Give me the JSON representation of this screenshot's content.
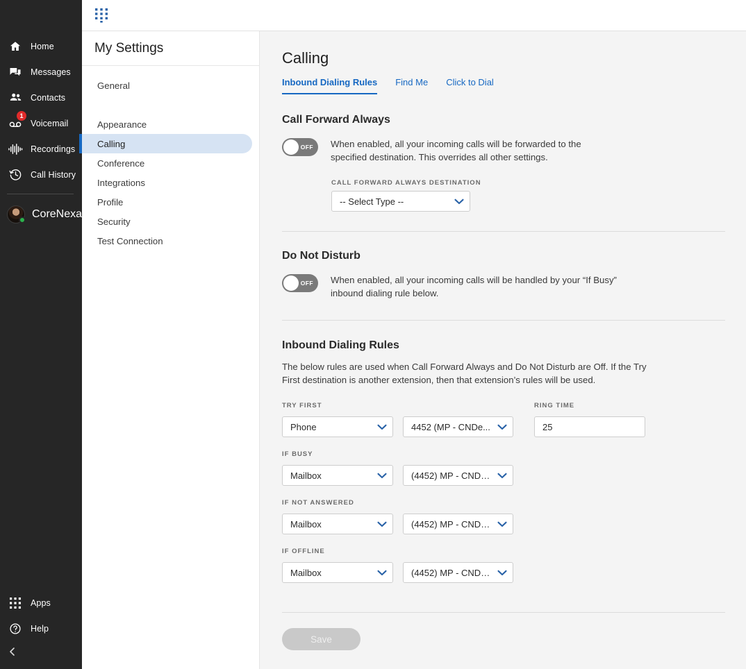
{
  "colors": {
    "rail_bg": "#262626",
    "accent_blue": "#1668c2",
    "active_nav_bg": "#d6e3f3",
    "main_bg": "#f4f4f4",
    "toggle_off": "#7a7a7a",
    "badge_red": "#e02b2b",
    "status_green": "#2bb24c",
    "save_disabled": "#c9c9c9"
  },
  "rail": {
    "items": [
      {
        "label": "Home",
        "icon": "home-icon",
        "badge": null
      },
      {
        "label": "Messages",
        "icon": "messages-icon",
        "badge": null
      },
      {
        "label": "Contacts",
        "icon": "contacts-icon",
        "badge": null
      },
      {
        "label": "Voicemail",
        "icon": "voicemail-icon",
        "badge": "1"
      },
      {
        "label": "Recordings",
        "icon": "recordings-icon",
        "badge": null
      },
      {
        "label": "Call History",
        "icon": "call-history-icon",
        "badge": null
      }
    ],
    "user": {
      "name": "CoreNexa",
      "presence": "online"
    },
    "bottom_items": [
      {
        "label": "Apps",
        "icon": "apps-grid-icon"
      },
      {
        "label": "Help",
        "icon": "help-circle-icon"
      }
    ],
    "collapse_icon": "chevron-left-icon"
  },
  "topbar": {
    "dialpad_icon": "dialpad-icon"
  },
  "settings": {
    "title": "My Settings",
    "items": [
      {
        "label": "General",
        "active": false
      },
      {
        "label": "Appearance",
        "active": false
      },
      {
        "label": "Calling",
        "active": true
      },
      {
        "label": "Conference",
        "active": false
      },
      {
        "label": "Integrations",
        "active": false
      },
      {
        "label": "Profile",
        "active": false
      },
      {
        "label": "Security",
        "active": false
      },
      {
        "label": "Test Connection",
        "active": false
      }
    ]
  },
  "main": {
    "page_title": "Calling",
    "tabs": [
      {
        "label": "Inbound Dialing Rules",
        "active": true
      },
      {
        "label": "Find Me",
        "active": false
      },
      {
        "label": "Click to Dial",
        "active": false
      }
    ],
    "call_forward_always": {
      "title": "Call Forward Always",
      "toggle_state": "OFF",
      "description": "When enabled, all your incoming calls will be forwarded to the specified destination. This overrides all other settings.",
      "dest_label": "CALL FORWARD ALWAYS DESTINATION",
      "dest_value": "-- Select Type --"
    },
    "do_not_disturb": {
      "title": "Do Not Disturb",
      "toggle_state": "OFF",
      "description": "When enabled, all your incoming calls will be handled by your “If Busy” inbound dialing rule below."
    },
    "inbound_dialing_rules": {
      "title": "Inbound Dialing Rules",
      "description": "The below rules are used when Call Forward Always and Do Not Disturb are Off. If the Try First destination is another extension, then that extension’s rules will be used.",
      "ring_time_label": "RING TIME",
      "ring_time_value": "25",
      "rows": [
        {
          "label": "TRY FIRST",
          "type_value": "Phone",
          "dest_value": "4452 (MP - CNDe...",
          "has_ring_time": true
        },
        {
          "label": "IF BUSY",
          "type_value": "Mailbox",
          "dest_value": "(4452) MP - CNDe...",
          "has_ring_time": false
        },
        {
          "label": "IF NOT ANSWERED",
          "type_value": "Mailbox",
          "dest_value": "(4452) MP - CNDe...",
          "has_ring_time": false
        },
        {
          "label": "IF OFFLINE",
          "type_value": "Mailbox",
          "dest_value": "(4452) MP - CNDe...",
          "has_ring_time": false
        }
      ]
    },
    "save_label": "Save"
  }
}
